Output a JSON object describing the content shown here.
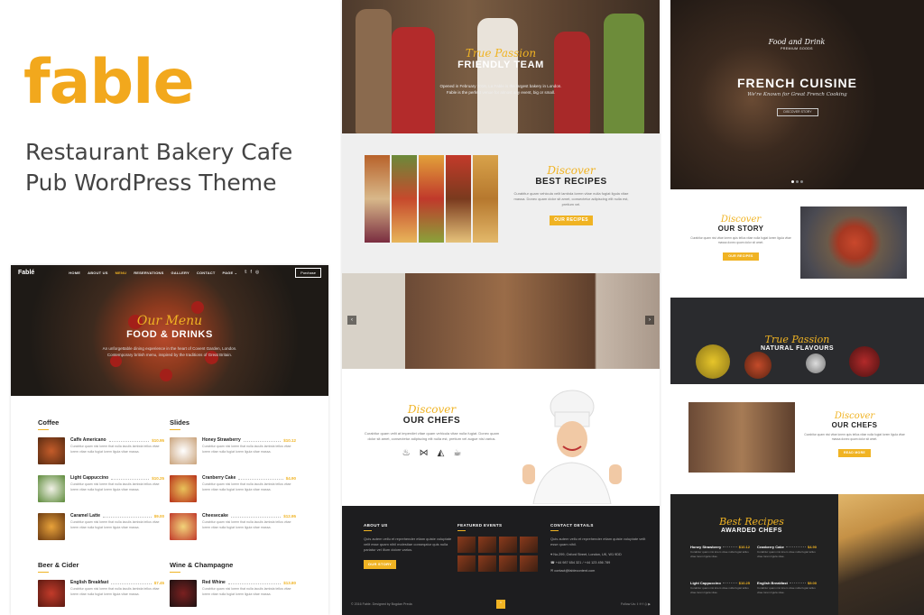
{
  "intro": {
    "brand": "fable",
    "tagline_line1": "Restaurant Bakery Cafe",
    "tagline_line2": "Pub WordPress Theme"
  },
  "colors": {
    "accent": "#f0b323",
    "brand": "#f2a81d",
    "dark": "#1d1d1f"
  },
  "left_panel": {
    "logo": "Fablé",
    "nav": [
      "HOME",
      "ABOUT US",
      "MENU",
      "RESERVATIONS",
      "GALLERY",
      "CONTACT",
      "PAGE ⌄"
    ],
    "nav_active": "MENU",
    "social_icons": [
      "twitter-icon",
      "facebook-icon",
      "instagram-icon"
    ],
    "purchase": "Purchase",
    "hero_script": "Our Menu",
    "hero_title": "FOOD & DRINKS",
    "hero_desc_1": "An unforgettable dining experience in the heart of Covent Garden, London.",
    "hero_desc_2": "Contemporary british menu, inspired by the traditions of Great Britain.",
    "col1_title": "Coffee",
    "col1_items": [
      {
        "name": "Caffe Americano",
        "price": "$10.95"
      },
      {
        "name": "Light Cappuccino",
        "price": "$10.25"
      },
      {
        "name": "Caramel Latte",
        "price": "$9.00"
      }
    ],
    "col2_title": "Slides",
    "col2_items": [
      {
        "name": "Honey Strawberry",
        "price": "$10.12"
      },
      {
        "name": "Cranberry Cake",
        "price": "$4.90"
      },
      {
        "name": "Cheesecake",
        "price": "$12.95"
      }
    ],
    "col3_title": "Beer & Cider",
    "col3_items": [
      {
        "name": "English Breakfast",
        "price": "$7.45"
      }
    ],
    "col4_title": "Wine & Champagne",
    "col4_items": [
      {
        "name": "Red Whine",
        "price": "$13.80"
      }
    ],
    "item_desc": "Curabitur quam nisi lorem that nulla iaculis lambda tellus vitae lorem vitae nulla fugiat lorem ligula vitae massa."
  },
  "middle_panel": {
    "hero_script": "True Passion",
    "hero_title": "FRIENDLY TEAM",
    "hero_desc_1": "Opened in February 2016, La Fable is the largest bakery in London.",
    "hero_desc_2": "Fable is the perfect venue for almost any event, big or small.",
    "recipes_script": "Discover",
    "recipes_title": "BEST RECIPES",
    "recipes_desc": "Curabitur quam vehicula velit lambda lorem vitae nulla fugiat ligula vitae massa. Donec quam dolor sit amet, consectetur adipiscing elit nulla est, pretium vel.",
    "recipes_btn": "OUR RECIPES",
    "chefs_script": "Discover",
    "chefs_title": "OUR CHEFS",
    "chefs_desc": "Curabitur quam velit at imperdiet vitae quam vehicula vitae nulla fugiat. Donec quam dolor sit amet, consectetur adipiscing elit nulla est, pretium vel augue nisi varius.",
    "chefs_icons": [
      "pot-icon",
      "fish-icon",
      "cake-icon",
      "cup-icon"
    ],
    "footer_about_title": "ABOUT US",
    "footer_about_desc": "Quis autem vellu et reprehender etiam quiste voluptate velit esse quam nihil molestiae conseqatur quis nulla pariatur vel illum dolore varius.",
    "footer_about_btn": "OUR STORY",
    "footer_events_title": "FEATURED EVENTS",
    "footer_contact_title": "CONTACT DETAILS",
    "footer_contact_desc": "Quis autem vellu et reprehender etiam quiste voluptate velit esse quam nihil.",
    "footer_address": "No.299, Oxford Street, London, UK, W1 9DD",
    "footer_phone": "+44 987 654 321 / +44 123 456 789",
    "footer_email": "contact@fablecontent.com",
    "copyright": "© 2016 Fable. Designed by Bogdan Preda",
    "follow_us": "Follow Us:",
    "follow_icons": [
      "twitter-icon",
      "pinterest-icon",
      "facebook-icon",
      "instagram-icon",
      "youtube-icon"
    ],
    "top_btn": "⌃"
  },
  "right_panel": {
    "badge_title": "Food and Drink",
    "badge_sub": "PREMIUM GOODS",
    "hero_title": "FRENCH CUISINE",
    "hero_sub": "We're Known for Great French Cooking",
    "hero_btn": "DISCOVER STORY",
    "story_script": "Discover",
    "story_title": "OUR STORY",
    "story_desc": "Curabitur quam nisi vitae lorem quis tellus vitae nulla fugiat lorem ligula vitae massa donec quam dolor sit amet.",
    "story_btn": "OUR RECIPES",
    "flav_script": "True Passion",
    "flav_title": "NATURAL FLAVOURS",
    "chefs_script": "Discover",
    "chefs_title": "OUR CHEFS",
    "chefs_desc": "Curabitur quam nisi vitae lorem quis tellus vitae nulla fugiat lorem ligula vitae massa donec quam dolor sit amet.",
    "chefs_btn": "READ MORE",
    "awards_script": "Best Recipes",
    "awards_title": "AWARDED CHEFS",
    "awards_items": [
      {
        "name": "Honey Strawberry",
        "price": "$10.12"
      },
      {
        "name": "Cranberry Cake",
        "price": "$4.90"
      },
      {
        "name": "Light Cappuccino",
        "price": "$10.25"
      },
      {
        "name": "English Breakfast",
        "price": "$9.00"
      }
    ],
    "awards_desc": "Curabitur quam nisi lorem vitae nulla fugiat tellus vitae lorem ligula vitae."
  }
}
